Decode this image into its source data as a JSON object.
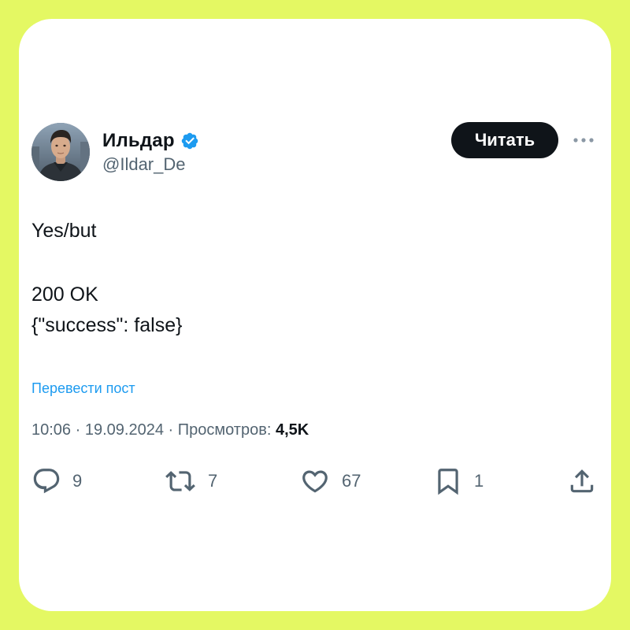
{
  "post": {
    "author": {
      "display_name": "Ильдар",
      "handle": "@Ildar_De",
      "verified": true
    },
    "follow_label": "Читать",
    "text": {
      "line1": "Yes/but",
      "line2": "200 OK",
      "line3": "{\"success\": false}"
    },
    "translate_label": "Перевести пост",
    "meta": {
      "time": "10:06",
      "date": "19.09.2024",
      "views_label": "Просмотров:",
      "views_count": "4,5K"
    },
    "actions": {
      "replies": "9",
      "reposts": "7",
      "likes": "67",
      "bookmarks": "1"
    }
  },
  "colors": {
    "page_background": "#e4f863",
    "card_background": "#ffffff",
    "primary_text": "#0f1419",
    "secondary_text": "#536471",
    "link": "#1d9bf0",
    "verified_badge": "#1d9bf0",
    "follow_button": "#0f1419"
  },
  "icons": {
    "verified": "verified-badge-icon",
    "more": "more-dots-icon",
    "reply": "reply-bubble-icon",
    "repost": "repost-arrows-icon",
    "like": "heart-icon",
    "bookmark": "bookmark-icon",
    "share": "share-upload-icon"
  }
}
